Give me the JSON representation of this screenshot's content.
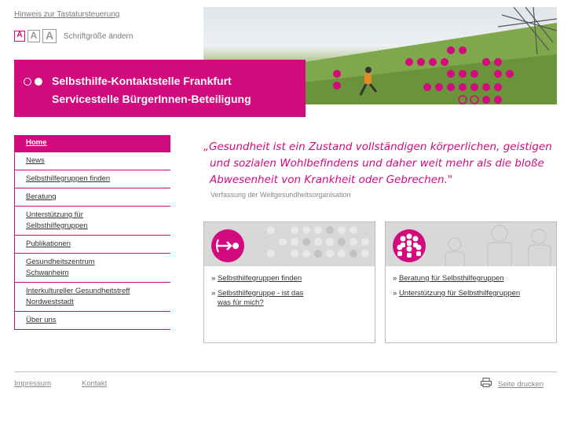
{
  "skip_link": "Hinweis zur Tastatursteuerung",
  "font_size": {
    "buttons": [
      "A",
      "A",
      "A"
    ],
    "label": "Schriftgröße ändern"
  },
  "header": {
    "title_line1": "Selbsthilfe-Kontaktstelle Frankfurt",
    "title_line2": "Servicestelle BürgerInnen-Beteiligung"
  },
  "nav": [
    {
      "label": "Home"
    },
    {
      "label": "News"
    },
    {
      "label": "Selbsthilfegruppen finden"
    },
    {
      "label": "Beratung"
    },
    {
      "label": "Unterstützung für",
      "label2": "Selbsthilfegruppen"
    },
    {
      "label": "Publikationen"
    },
    {
      "label": "Gesundheitszentrum",
      "label2": "Schwanheim"
    },
    {
      "label": "Interkultureller Gesundheitstreff",
      "label2": "Nordweststadt"
    },
    {
      "label": "Über uns"
    }
  ],
  "quote": {
    "line1": "„Gesundheit ist ein Zustand vollständigen körperlichen, geistigen",
    "line2": "und sozialen Wohlbefindens und daher weit mehr als die bloße",
    "line3": "Abwesenheit von Krankheit oder Gebrechen.\"",
    "source": "Verfassung der Weltgesundheitsorganisation"
  },
  "box1": {
    "links": [
      {
        "label": "Selbsthilfegruppen finden"
      },
      {
        "label": "Selbsthilfegruppe - ist das",
        "label2": "was für mich?"
      }
    ]
  },
  "box2": {
    "links": [
      {
        "label": "Beratung für Selbsthilfegruppen"
      },
      {
        "label": "Unterstützung für Selbsthilfegruppen"
      }
    ]
  },
  "footer": {
    "impressum": "Impressum",
    "kontakt": "Kontakt",
    "print": "Seite drucken"
  },
  "colors": {
    "accent": "#d10a7e"
  }
}
